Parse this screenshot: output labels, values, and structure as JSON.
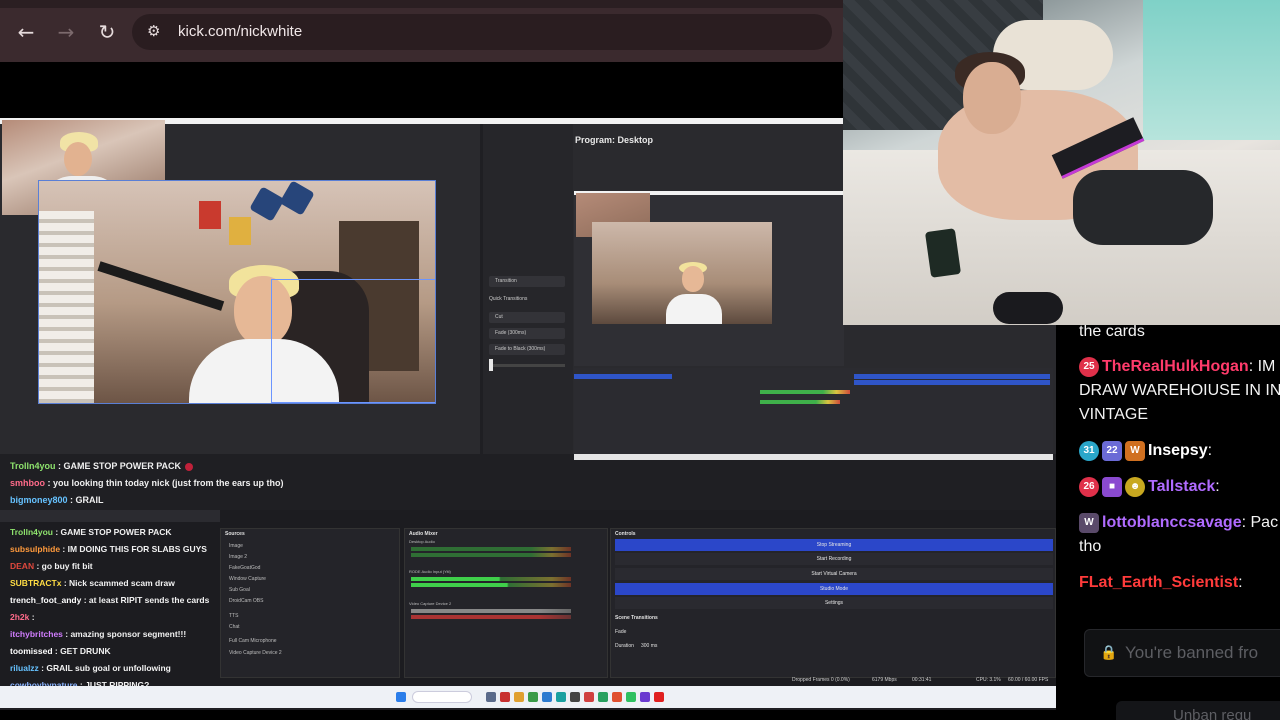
{
  "browser": {
    "url": "kick.com/nickwhite",
    "back_icon": "←",
    "forward_icon": "→",
    "reload_icon": "↻",
    "site_info_icon": "⚙"
  },
  "obs": {
    "program_title": "Program: Desktop",
    "transition_panel": {
      "transition_label": "Transition",
      "quick_transitions_label": "Quick Transitions",
      "items": [
        "Cut",
        "Fade (300ms)",
        "Fade to Black (300ms)"
      ]
    },
    "docks": {
      "sources_title": "Sources",
      "audio_mixer_title": "Audio Mixer",
      "controls_title": "Controls",
      "sources": [
        "Image",
        "Image 2",
        "FakeGoatGod",
        "Window Capture",
        "Sub Goal",
        "DroidCam OBS",
        "TTS",
        "Chat",
        "Full Cam Microphone",
        "Video Capture Device 2"
      ],
      "mixer_channels": [
        "Desktop Audio",
        "RODE Audio Input (Yiti)",
        "Video Capture Device 2"
      ],
      "controls": [
        "Stop Streaming",
        "Start Recording",
        "Start Virtual Camera",
        "Studio Mode",
        "Settings"
      ],
      "scene_transitions_title": "Scene Transitions",
      "transition_value": "Fade",
      "duration_label": "Duration",
      "duration_value": "300 ms"
    },
    "status_bar": {
      "dropped": "Dropped Frames 0 (0.0%)",
      "bitrate": "6179 Mbps",
      "time": "00:31:41",
      "cpu": "CPU: 3.1%",
      "fps": "60.00 / 60.00 FPS"
    }
  },
  "stream_chat": [
    {
      "user": "Trolln4you",
      "text": " : GAME STOP POWER PACK",
      "color": "#8ee36d"
    },
    {
      "user": "smhboo",
      "text": " : you looking thin today nick (just from the ears up tho)",
      "color": "#ff6b8a"
    },
    {
      "user": "bigmoney800",
      "text": " : GRAIL",
      "color": "#66c2ff"
    }
  ],
  "bottom_chat": [
    {
      "user": "Trolln4you",
      "text": " : GAME STOP POWER PACK",
      "color": "#8ee36d"
    },
    {
      "user": "subsulphide",
      "text": " : IM DOING THIS FOR SLABS GUYS",
      "color": "#ff9a3c"
    },
    {
      "user": "DEAN",
      "text": " : go buy fit bit",
      "color": "#e0483d"
    },
    {
      "user": "SUBTRACTx",
      "text": " : Nick scammed scam draw",
      "color": "#ffdd44"
    },
    {
      "user": "trench_foot_andy",
      "text": " : at least RIPIT sends the cards",
      "color": "#ffffff"
    },
    {
      "user": "2h2k",
      "text": " : ",
      "color": "#ff6b8a"
    },
    {
      "user": "itchybritches",
      "text": " : amazing sponsor segment!!!",
      "color": "#d17dff"
    },
    {
      "user": "toomissed",
      "text": " : GET DRUNK",
      "color": "#ffffff"
    },
    {
      "user": "rilualzz",
      "text": " : GRAIL sub goal or unfollowing",
      "color": "#66c2ff"
    },
    {
      "user": "cowboybypature",
      "text": " : JUST RIPPING?",
      "color": "#8ab4ff"
    }
  ],
  "kick_chat": {
    "messages": [
      {
        "badges": [],
        "user": "",
        "text": "the cards",
        "user_color": "#ffffff"
      },
      {
        "badges": [
          "25"
        ],
        "user": "TheRealHulkHogan",
        "text": ": IM",
        "user_color": "#ff3b6b"
      },
      {
        "badges": [],
        "user": "",
        "text": "DRAW WAREHOIUSE IN INDI",
        "user_color": "#ffffff"
      },
      {
        "badges": [],
        "user": "",
        "text": "VINTAGE",
        "user_color": "#ffffff"
      },
      {
        "badges": [
          "31",
          "22",
          "W"
        ],
        "user": "Insepsy",
        "text": ":",
        "user_color": "#ffffff"
      },
      {
        "badges": [
          "26",
          "■",
          "☻"
        ],
        "user": "Tallstack",
        "text": ":",
        "user_color": "#b06bff"
      },
      {
        "badges": [
          "W"
        ],
        "user": "lottoblanccsavage",
        "text": ": Pac",
        "user_color": "#b06bff"
      },
      {
        "badges": [],
        "user": "",
        "text": "tho",
        "user_color": "#ffffff"
      },
      {
        "badges": [],
        "user": "FLat_Earth_Scientist",
        "text": ":",
        "user_color": "#ff3b3b"
      }
    ],
    "input_placeholder": "You're banned fro",
    "lock_icon": "🔒",
    "unban_label": "Unban requ"
  }
}
